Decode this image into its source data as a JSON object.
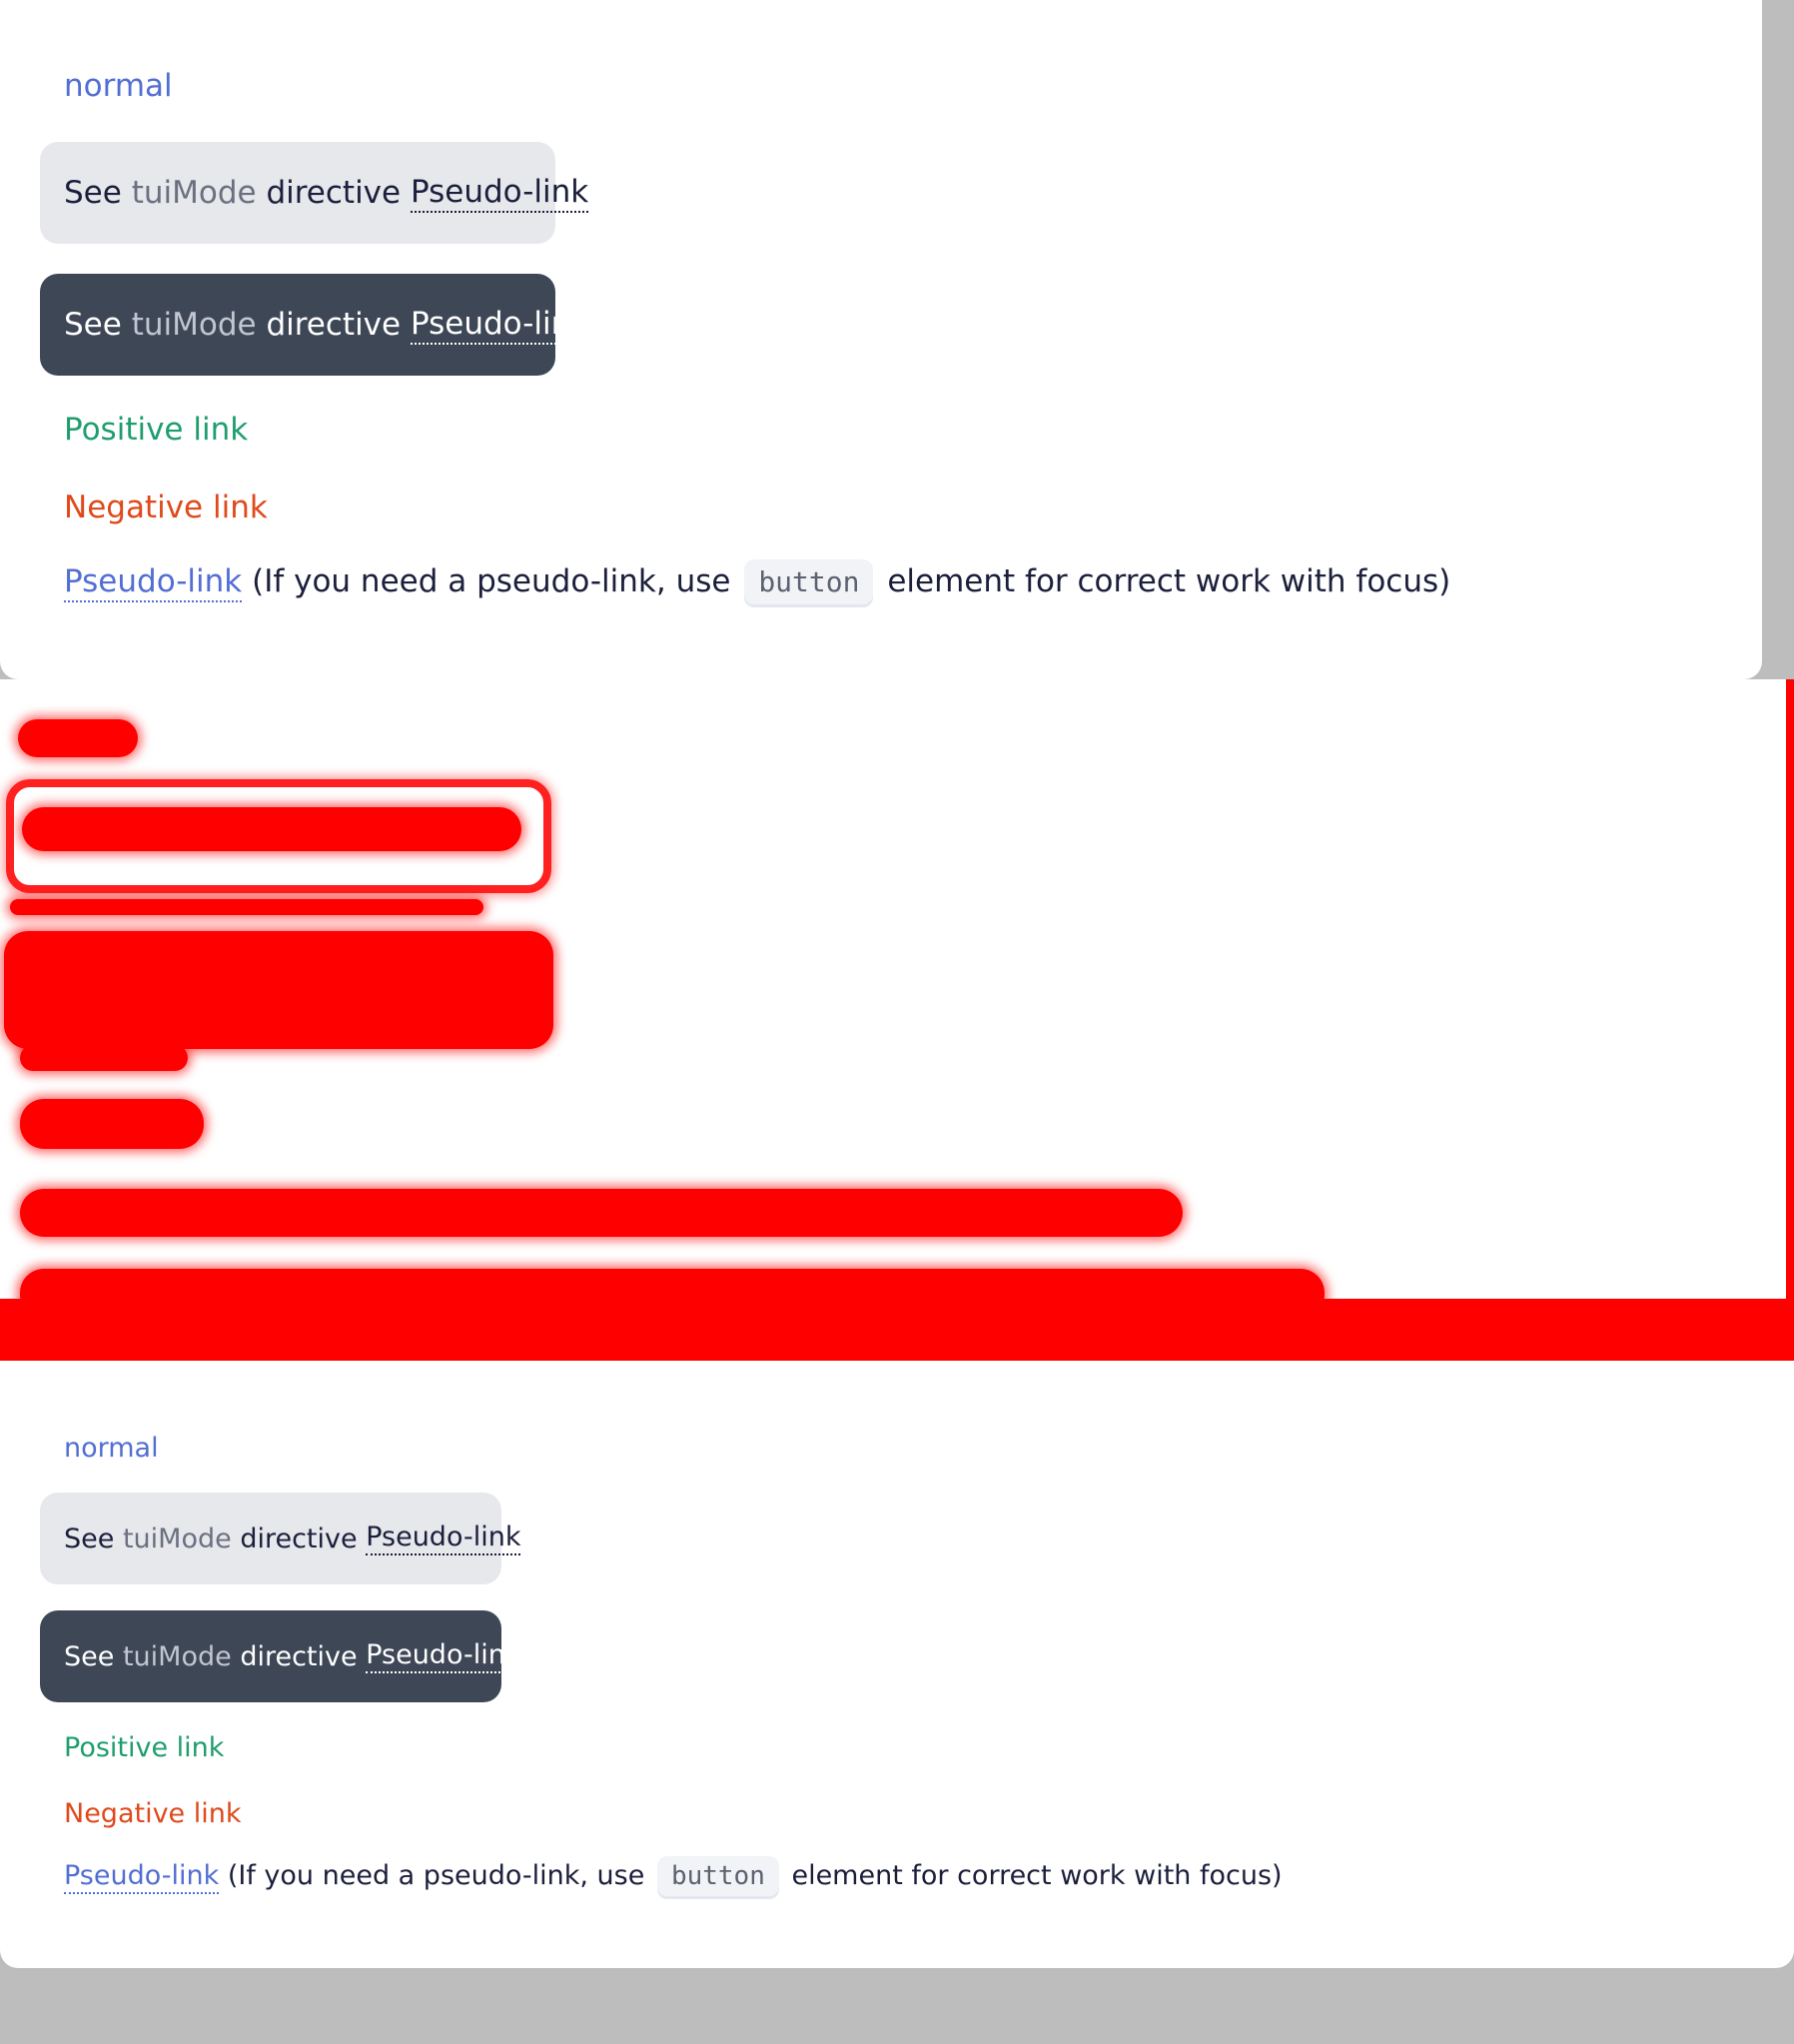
{
  "section1": {
    "normal_link": "normal",
    "card_light": {
      "see": "See",
      "mode": "tuiMode",
      "directive": "directive",
      "pseudo": "Pseudo-link"
    },
    "card_dark": {
      "see": "See",
      "mode": "tuiMode",
      "directive": "directive",
      "pseudo": "Pseudo-link"
    },
    "positive_link": "Positive link",
    "negative_link": "Negative link",
    "pseudo_link": "Pseudo-link",
    "note_before": "(If you need a pseudo-link, use",
    "code": "button",
    "note_after": "element for correct work with focus)"
  },
  "section2": {
    "normal_link": "normal",
    "card_light": {
      "see": "See",
      "mode": "tuiMode",
      "directive": "directive",
      "pseudo": "Pseudo-link"
    },
    "card_dark": {
      "see": "See",
      "mode": "tuiMode",
      "directive": "directive",
      "pseudo": "Pseudo-link"
    },
    "positive_link": "Positive link",
    "negative_link": "Negative link",
    "pseudo_link": "Pseudo-link",
    "note_before": "(If you need a pseudo-link, use",
    "code": "button",
    "note_after": "element for correct work with focus)"
  },
  "colors": {
    "primary_link": "#526ed3",
    "positive_link": "#1e9e6e",
    "negative_link": "#e0491b",
    "dark_card": "#3e4756",
    "light_card": "#e7e8ec",
    "redaction": "#ff0000"
  }
}
